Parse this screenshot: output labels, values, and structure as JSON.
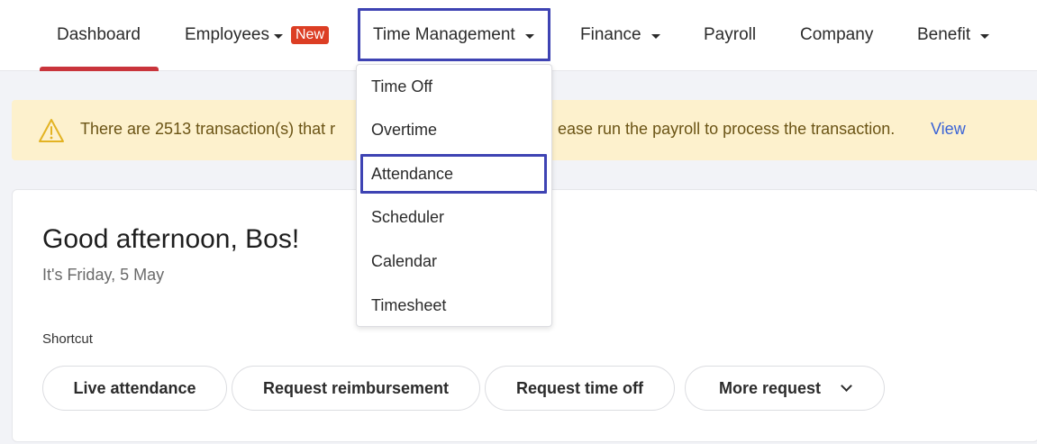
{
  "nav": {
    "items": [
      {
        "label": "Dashboard"
      },
      {
        "label": "Employees",
        "badge": "New"
      },
      {
        "label": "Time Management"
      },
      {
        "label": "Finance"
      },
      {
        "label": "Payroll"
      },
      {
        "label": "Company"
      },
      {
        "label": "Benefit"
      }
    ],
    "active_item": "Dashboard",
    "open_menu": "Time Management"
  },
  "dropdown": {
    "items": [
      "Time Off",
      "Overtime",
      "Attendance",
      "Scheduler",
      "Calendar",
      "Timesheet"
    ],
    "highlighted": "Attendance"
  },
  "alert": {
    "text_before": "There are 2513 transaction(s) that r",
    "text_after": "ease run the payroll to process the transaction.",
    "link": "View",
    "icon": "warning-triangle-icon"
  },
  "main": {
    "greeting": "Good afternoon, Bos!",
    "date": "It's Friday, 5 May",
    "shortcut_label": "Shortcut",
    "shortcuts": [
      "Live attendance",
      "Request reimbursement",
      "Request time off",
      "More request"
    ]
  },
  "colors": {
    "active_bar": "#c9343b",
    "badge": "#dc3e24",
    "highlight_box": "#3e43b3",
    "alert_bg": "#fdf1cd",
    "link": "#3a63d6"
  }
}
